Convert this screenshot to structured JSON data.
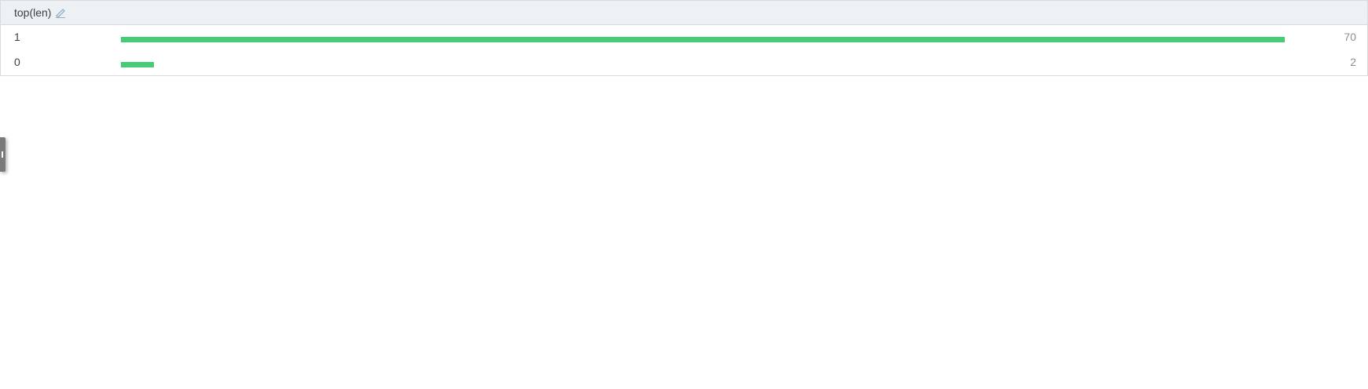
{
  "header": {
    "title": "top(len)"
  },
  "rows": [
    {
      "label": "1",
      "count": 70
    },
    {
      "label": "0",
      "count": 2
    }
  ],
  "max_count": 70,
  "colors": {
    "bar": "#44cc77"
  }
}
